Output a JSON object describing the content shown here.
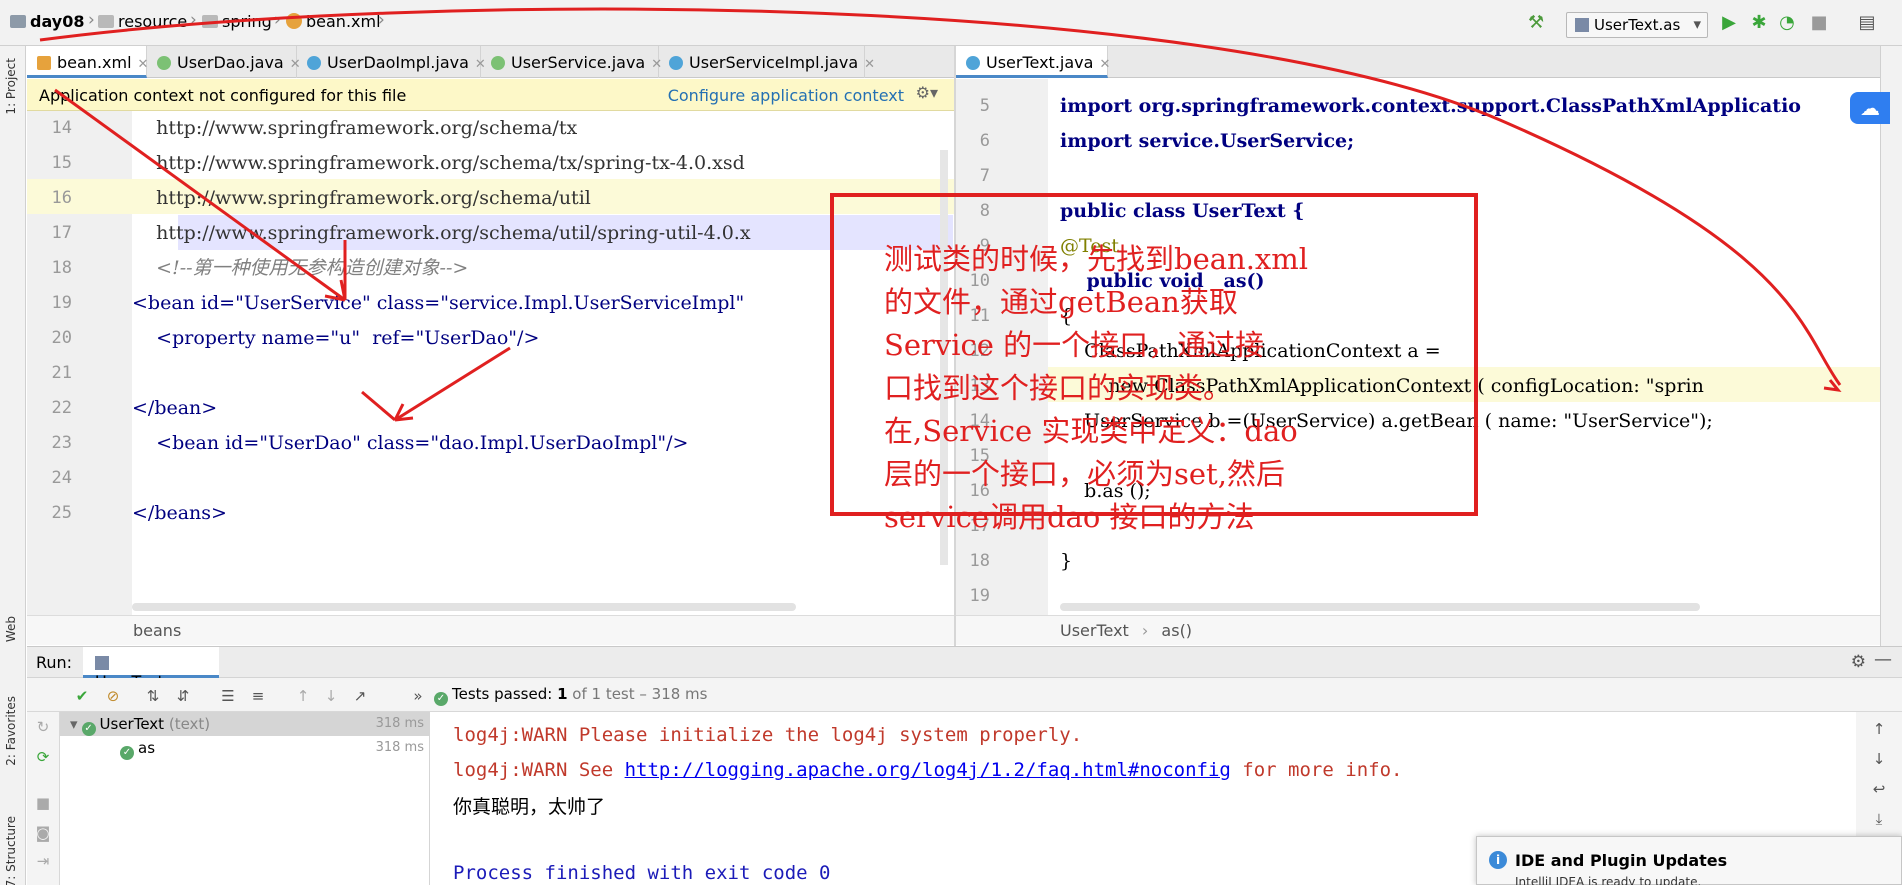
{
  "navbar": {
    "crumbs": [
      "day08",
      "resource",
      "spring",
      "bean.xml"
    ],
    "run_config": "UserText.as"
  },
  "left_tabs": [
    {
      "label": "bean.xml",
      "icon": "xml-file-icon",
      "active": true
    },
    {
      "label": "UserDao.java",
      "icon": "interface-icon"
    },
    {
      "label": "UserDaoImpl.java",
      "icon": "class-icon"
    },
    {
      "label": "UserService.java",
      "icon": "interface-icon"
    },
    {
      "label": "UserServiceImpl.java",
      "icon": "class-icon"
    }
  ],
  "right_tabs": [
    {
      "label": "UserText.java",
      "icon": "class-icon",
      "active": true
    }
  ],
  "banner": {
    "text": "Application context not configured for this file",
    "link": "Configure application context"
  },
  "left_editor": {
    "lines": [
      {
        "no": "14",
        "text": "    http://www.springframework.org/schema/tx"
      },
      {
        "no": "15",
        "text": "    http://www.springframework.org/schema/tx/spring-tx-4.0.xsd"
      },
      {
        "no": "16",
        "text": "    http://www.springframework.org/schema/util"
      },
      {
        "no": "17",
        "text": "    http://www.springframework.org/schema/util/spring-util-4.0.x"
      },
      {
        "no": "18",
        "text": "    <!--第一种使用无参构造创建对象-->"
      },
      {
        "no": "19",
        "text": "<bean id=\"UserService\" class=\"service.Impl.UserServiceImpl\""
      },
      {
        "no": "20",
        "text": "    <property name=\"u\"  ref=\"UserDao\"/>"
      },
      {
        "no": "21",
        "text": ""
      },
      {
        "no": "22",
        "text": "</bean>"
      },
      {
        "no": "23",
        "text": "    <bean id=\"UserDao\" class=\"dao.Impl.UserDaoImpl\"/>"
      },
      {
        "no": "24",
        "text": ""
      },
      {
        "no": "25",
        "text": "</beans>"
      }
    ],
    "breadcrumb": "beans"
  },
  "right_editor": {
    "lines": [
      {
        "no": "5",
        "text": "import org.springframework.context.support.ClassPathXmlApplicatio"
      },
      {
        "no": "6",
        "text": "import service.UserService;"
      },
      {
        "no": "7",
        "text": ""
      },
      {
        "no": "8",
        "text": "public class UserText {"
      },
      {
        "no": "9",
        "text": "@Test"
      },
      {
        "no": "10",
        "text": "    public void   as()"
      },
      {
        "no": "11",
        "text": "{"
      },
      {
        "no": "12",
        "text": "    ClassPathXmlApplicationContext a ="
      },
      {
        "no": "13",
        "text": "        new ClassPathXmlApplicationContext ( configLocation: \"sprin"
      },
      {
        "no": "14",
        "text": "    UserService b =(UserService) a.getBean ( name: \"UserService\");"
      },
      {
        "no": "15",
        "text": ""
      },
      {
        "no": "16",
        "text": "    b.as ();"
      },
      {
        "no": "17",
        "text": ""
      },
      {
        "no": "18",
        "text": "}"
      },
      {
        "no": "19",
        "text": ""
      }
    ],
    "breadcrumb": [
      "UserText",
      "as()"
    ]
  },
  "annotation": {
    "lines": [
      "测试类的时候，先找到bean.xml",
      "的文件，通过getBean获取",
      "Service 的一个接口，通过接",
      "口找到这个接口的实现类。",
      "在,Service 实现类中定义：dao",
      "层的一个接口，必须为set,然后",
      "service调用dao 接口的方法"
    ],
    "color": "#e02020"
  },
  "run": {
    "label": "Run:",
    "tab": "UserText.as",
    "status_prefix": "Tests passed:",
    "status_count": "1",
    "status_rest": "of 1 test – 318 ms",
    "tree": [
      {
        "name": "UserText",
        "detail": "(text)",
        "time": "318 ms"
      },
      {
        "name": "as",
        "detail": "",
        "time": "318 ms"
      }
    ],
    "console": {
      "warn1": "log4j:WARN Please initialize the log4j system properly.",
      "warn2_pre": "log4j:WARN See ",
      "warn2_link": "http://logging.apache.org/log4j/1.2/faq.html#noconfig",
      "warn2_post": " for more info.",
      "output": "你真聪明，太帅了",
      "exit": "Process finished with exit code 0"
    }
  },
  "side_labels": {
    "project": "1: Project",
    "web": "Web",
    "favorites": "2: Favorites",
    "structure": "7: Structure"
  },
  "popup": {
    "title": "IDE and Plugin Updates",
    "sub": "IntelliJ IDEA is ready to update."
  },
  "colors": {
    "accent": "#4a88c7",
    "annotation": "#e02020",
    "passed": "#59a869"
  }
}
